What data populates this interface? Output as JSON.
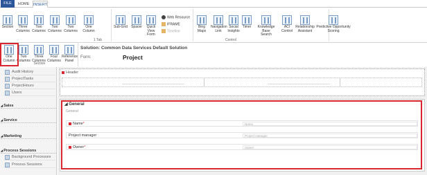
{
  "tabs": {
    "file": "FILE",
    "home": "HOME",
    "insert": "INSERT"
  },
  "ribbon": {
    "section_group": [
      {
        "label": "Section",
        "name": "section-button"
      },
      {
        "label": "Three\nColumns",
        "name": "three-columns-button"
      },
      {
        "label": "Two\nColumns",
        "name": "two-columns-button"
      },
      {
        "label": "Two\nColumns",
        "name": "two-columns-button-2"
      },
      {
        "label": "Two\nColumns",
        "name": "two-columns-button-3"
      },
      {
        "label": "One\nColumn",
        "name": "one-column-button"
      }
    ],
    "tab_group_label": "1 Tab",
    "control_items": [
      {
        "label": "Sub-Grid",
        "name": "sub-grid-button"
      },
      {
        "label": "Spacer",
        "name": "spacer-button"
      },
      {
        "label": "Quick View\nForm",
        "name": "quick-view-form-button"
      }
    ],
    "small_items": [
      {
        "label": "Web Resource",
        "name": "web-resource-button"
      },
      {
        "label": "IFRAME",
        "name": "iframe-button"
      },
      {
        "label": "Timeline",
        "name": "timeline-button"
      }
    ],
    "control_group2": [
      {
        "label": "Bing\nMaps",
        "name": "bing-maps-button"
      },
      {
        "label": "Navigation\nLink",
        "name": "navigation-link-button"
      },
      {
        "label": "Social\nInsights",
        "name": "social-insights-button"
      },
      {
        "label": "Timer",
        "name": "timer-button"
      },
      {
        "label": "Knowledge Base\nSearch",
        "name": "knowledge-base-search-button"
      },
      {
        "label": "ACI\nControl",
        "name": "aci-control-button"
      },
      {
        "label": "Relationship\nAssistant",
        "name": "relationship-assistant-button"
      },
      {
        "label": "Predictive Opportunity\nScoring",
        "name": "predictive-opportunity-scoring-button"
      }
    ],
    "control_group_label": "Control",
    "section_row2": [
      {
        "label": "One\nColumn",
        "name": "one-column-section-button"
      },
      {
        "label": "Two\nColumns",
        "name": "two-columns-section-button"
      },
      {
        "label": "Three\nColumns",
        "name": "three-columns-section-button"
      },
      {
        "label": "Four\nColumns",
        "name": "four-columns-section-button"
      },
      {
        "label": "Reference\nPanel",
        "name": "reference-panel-button"
      }
    ],
    "section_group_label": "Section"
  },
  "solution": {
    "title": "Solution: Common Data Services Default Solution",
    "form_label": "Form:",
    "form_name": "Project"
  },
  "nav": {
    "items_top": [
      "Audit History",
      "ProjectTasks",
      "ProjectHours",
      "Users"
    ],
    "sections": [
      "Sales",
      "Service",
      "Marketing",
      "Process Sessions"
    ],
    "items_bottom": [
      "Background Processes",
      "Process Sessions"
    ]
  },
  "canvas": {
    "header_label": "Header",
    "section_title": "General",
    "section_sub": "General",
    "fields": [
      {
        "label": "Name",
        "required": "*",
        "placeholder": "Name"
      },
      {
        "label": "Project manager",
        "required": "",
        "placeholder": "Project manager"
      },
      {
        "label": "Owner",
        "required": "*",
        "placeholder": "Owner"
      }
    ]
  },
  "colors": {
    "accent": "#2b579a",
    "highlight": "#d9262e"
  }
}
